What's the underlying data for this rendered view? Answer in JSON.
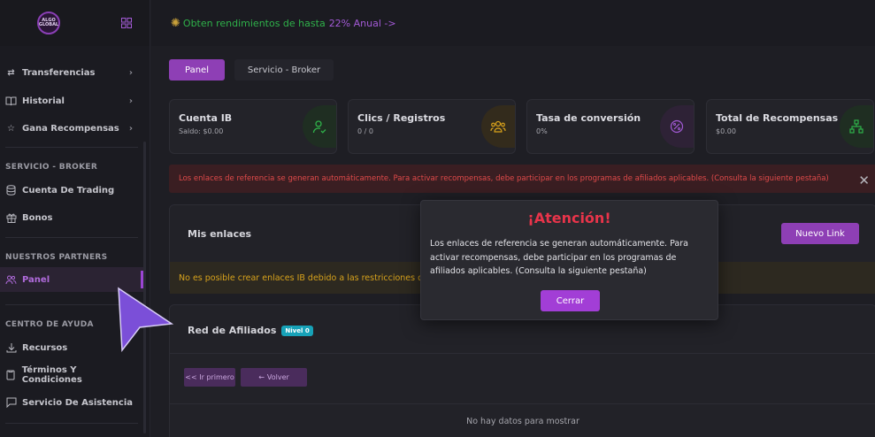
{
  "logo": {
    "text": "ALGO GLOBAL"
  },
  "topbar": {
    "promo_text": "Obten rendimientos de hasta",
    "promo_link": "22% Anual ->"
  },
  "sidebar": {
    "items": [
      {
        "label": "Transferencias",
        "icon": "transfer-icon",
        "has_chevron": true
      },
      {
        "label": "Historial",
        "icon": "book-icon",
        "has_chevron": true
      },
      {
        "label": "Gana Recompensas",
        "icon": "star-icon",
        "has_chevron": true
      }
    ],
    "section_broker": "SERVICIO - BROKER",
    "broker_items": [
      {
        "label": "Cuenta De Trading",
        "icon": "database-icon"
      },
      {
        "label": "Bonos",
        "icon": "gift-icon"
      }
    ],
    "section_partners": "NUESTROS PARTNERS",
    "partners_items": [
      {
        "label": "Panel",
        "icon": "users-icon",
        "active": true
      }
    ],
    "section_help": "CENTRO DE AYUDA",
    "help_items": [
      {
        "label": "Recursos",
        "icon": "download-icon"
      },
      {
        "label": "Términos Y Condiciones",
        "icon": "document-icon"
      },
      {
        "label": "Servicio De Asistencia",
        "icon": "chat-icon"
      }
    ]
  },
  "tabs": {
    "panel": "Panel",
    "broker": "Servicio - Broker"
  },
  "cards": [
    {
      "title": "Cuenta IB",
      "sub": "Saldo: $0.00",
      "icon": "user-check-icon",
      "color": "#2fb24a"
    },
    {
      "title": "Clics / Registros",
      "sub": "0 / 0",
      "icon": "users-group-icon",
      "color": "#d9a21b"
    },
    {
      "title": "Tasa de conversión",
      "sub": "0%",
      "icon": "percent-icon",
      "color": "#a35ad6"
    },
    {
      "title": "Total de Recompensas",
      "sub": "$0.00",
      "icon": "network-icon",
      "color": "#2fb24a"
    }
  ],
  "alert": {
    "text": "Los enlaces de referencia se generan automáticamente. Para activar recompensas, debe participar en los programas de afiliados aplicables. (Consulta la siguiente pestaña)",
    "close": "✕"
  },
  "links_panel": {
    "title": "Mis enlaces",
    "new_button": "Nuevo Link",
    "warning": "No es posible crear enlaces IB debido a las restricciones d"
  },
  "affiliates_panel": {
    "title": "Red de Afiliados",
    "badge": "Nivel 0",
    "first_button": "<< Ir primero",
    "back_button": "Volver",
    "empty": "No hay datos para mostrar"
  },
  "modal": {
    "title": "¡Atención!",
    "body": "Los enlaces de referencia se generan automáticamente. Para activar recompensas, debe participar en los programas de afiliados aplicables. (Consulta la siguiente pestaña)",
    "button": "Cerrar"
  },
  "colors": {
    "accent": "#8e3fb5",
    "danger": "#e8344a",
    "success": "#2fb24a",
    "warning": "#d7a21c"
  }
}
